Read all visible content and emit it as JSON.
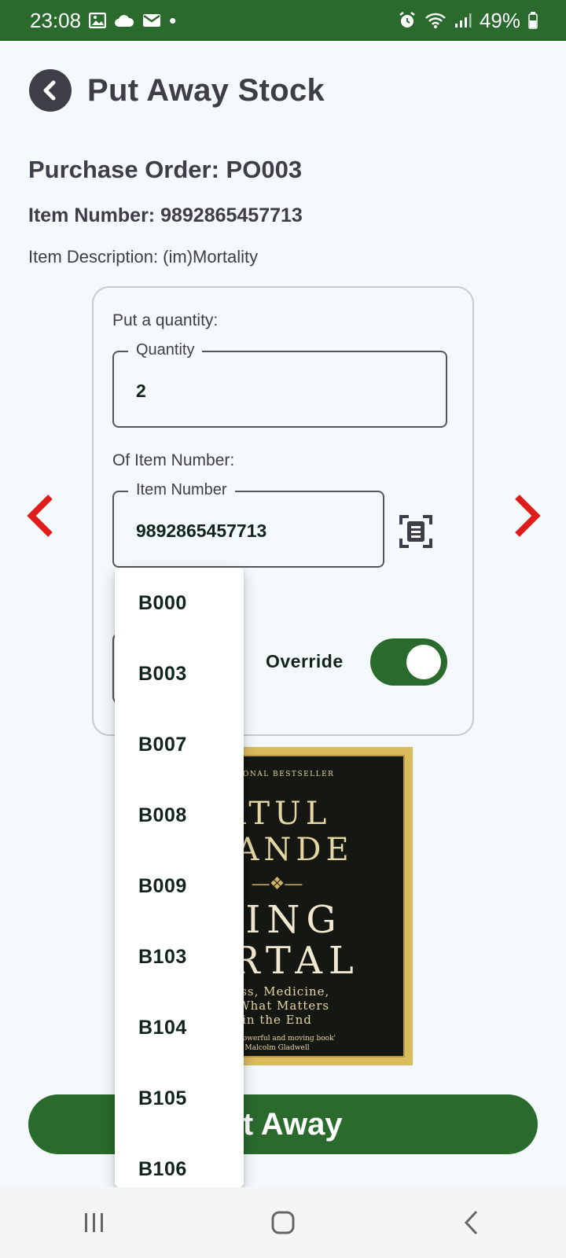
{
  "status_bar": {
    "time": "23:08",
    "dot": "•",
    "battery": "49%",
    "icons": [
      "image-icon",
      "cloud-icon",
      "mail-icon",
      "alarm-icon",
      "wifi-icon",
      "signal-icon",
      "battery-icon"
    ]
  },
  "header": {
    "title": "Put Away Stock",
    "back_icon": "back-arrow-icon"
  },
  "order": {
    "purchase_order": "Purchase Order: PO003",
    "item_number": "Item Number: 9892865457713",
    "item_description": "Item Description: (im)Mortality"
  },
  "form": {
    "quantity_prompt": "Put a quantity:",
    "quantity_legend": "Quantity",
    "quantity_value": "2",
    "item_prompt": "Of Item Number:",
    "item_legend": "Item Number",
    "item_value": "9892865457713",
    "scan_icon": "barcode-scan-icon",
    "override_label": "Override",
    "override_on": true
  },
  "bin_dropdown": {
    "options": [
      "B000",
      "B003",
      "B007",
      "B008",
      "B009",
      "B103",
      "B104",
      "B105",
      "B106"
    ]
  },
  "book_cover": {
    "top_line": "NATIONAL BESTSELLER",
    "author_line1": "ATUL",
    "author_line2": "WANDE",
    "title_line1": "EING",
    "title_line2": "ORTAL",
    "subtitle_line1": "ness, Medicine,",
    "subtitle_line2": "d What Matters",
    "subtitle_line3": "in the End",
    "quote_line1": "most powerful and moving book'",
    "quote_line2": "Malcolm Gladwell"
  },
  "action": {
    "put_away_label": "ut Away"
  },
  "colors": {
    "brand_green": "#2a6a2d",
    "arrow_red": "#e01b1b",
    "text_dark": "#3f3d48"
  }
}
